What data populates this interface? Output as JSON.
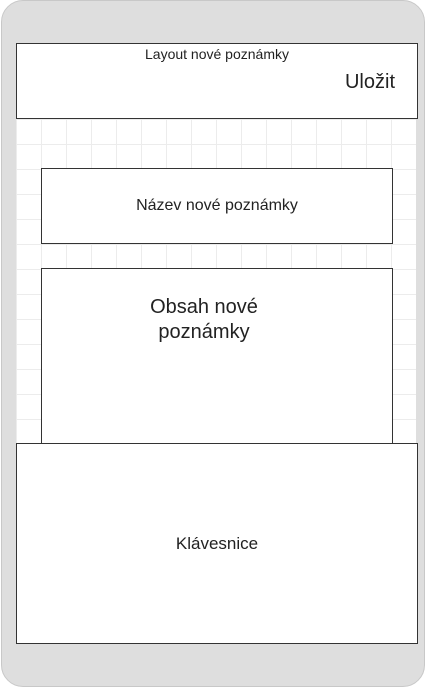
{
  "header": {
    "title": "Layout nové poznámky",
    "save_label": "Uložit"
  },
  "note_name": {
    "label": "Název nové poznámky"
  },
  "note_content": {
    "label": "Obsah nové poznámky"
  },
  "keyboard": {
    "label": "Klávesnice"
  }
}
